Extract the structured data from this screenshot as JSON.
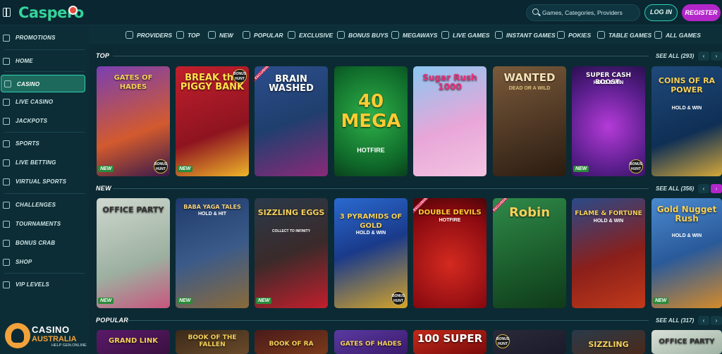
{
  "header": {
    "logo": "Caspero",
    "search_placeholder": "Games, Categories, Providers",
    "login_label": "LOG IN",
    "register_label": "REGISTER"
  },
  "sidebar": {
    "items": [
      {
        "label": "PROMOTIONS",
        "icon": "promotions-icon"
      },
      {
        "label": "HOME",
        "icon": "home-icon"
      },
      {
        "label": "CASINO",
        "icon": "casino-icon",
        "active": true
      },
      {
        "label": "LIVE CASINO",
        "icon": "live-casino-icon"
      },
      {
        "label": "JACKPOTS",
        "icon": "jackpots-icon"
      },
      {
        "label": "SPORTS",
        "icon": "sports-icon"
      },
      {
        "label": "LIVE BETTING",
        "icon": "live-betting-icon"
      },
      {
        "label": "VIRTUAL SPORTS",
        "icon": "virtual-sports-icon"
      },
      {
        "label": "CHALLENGES",
        "icon": "challenges-icon"
      },
      {
        "label": "TOURNAMENTS",
        "icon": "tournaments-icon"
      },
      {
        "label": "BONUS CRAB",
        "icon": "bonus-crab-icon"
      },
      {
        "label": "SHOP",
        "icon": "shop-icon"
      },
      {
        "label": "VIP LEVELS",
        "icon": "vip-levels-icon"
      }
    ]
  },
  "categories": [
    {
      "label": "PROVIDERS",
      "icon": "providers-icon"
    },
    {
      "label": "TOP",
      "icon": "top-icon"
    },
    {
      "label": "NEW",
      "icon": "new-icon"
    },
    {
      "label": "POPULAR",
      "icon": "popular-icon"
    },
    {
      "label": "EXCLUSIVE",
      "icon": "exclusive-icon"
    },
    {
      "label": "BONUS BUYS",
      "icon": "bonus-buys-icon"
    },
    {
      "label": "MEGAWAYS",
      "icon": "megaways-icon"
    },
    {
      "label": "LIVE GAMES",
      "icon": "live-games-icon"
    },
    {
      "label": "INSTANT GAMES",
      "icon": "instant-games-icon"
    },
    {
      "label": "POKIES",
      "icon": "pokies-icon"
    },
    {
      "label": "TABLE GAMES",
      "icon": "table-games-icon"
    },
    {
      "label": "ALL GAMES",
      "icon": "all-games-icon"
    }
  ],
  "sections": [
    {
      "title": "TOP",
      "see_all": "SEE ALL (293)",
      "games": [
        {
          "title": "GATES OF HADES",
          "sub": "",
          "new": "NEW",
          "hunt": true,
          "excl": false
        },
        {
          "title": "BREAK the PIGGY BANK",
          "sub": "",
          "new": "NEW",
          "hunt": true,
          "excl": false
        },
        {
          "title": "BRAIN WASHED",
          "sub": "",
          "new": "",
          "hunt": false,
          "excl": true
        },
        {
          "title": "40 MEGA",
          "sub": "HOTFIRE",
          "new": "",
          "hunt": false,
          "excl": false
        },
        {
          "title": "Sugar Rush 1000",
          "sub": "",
          "new": "",
          "hunt": false,
          "excl": false
        },
        {
          "title": "WANTED",
          "sub": "DEAD OR A WILD",
          "new": "",
          "hunt": false,
          "excl": false
        },
        {
          "title": "SUPER CASH BOOST:",
          "sub": "HOLD & WIN",
          "new": "NEW",
          "hunt": true,
          "excl": false
        },
        {
          "title": "COINS OF RA POWER",
          "sub": "HOLD & WIN",
          "new": "",
          "hunt": false,
          "excl": false
        }
      ]
    },
    {
      "title": "NEW",
      "see_all": "SEE ALL (356)",
      "games": [
        {
          "title": "OFFICE PARTY",
          "sub": "",
          "new": "NEW",
          "hunt": false,
          "excl": false
        },
        {
          "title": "BABA YAGA TALES",
          "sub": "HOLD & HIT",
          "new": "NEW",
          "hunt": false,
          "excl": false
        },
        {
          "title": "SIZZLING EGGS",
          "sub": "COLLECT TO INFINITY",
          "new": "NEW",
          "hunt": false,
          "excl": false
        },
        {
          "title": "3 PYRAMIDS OF GOLD",
          "sub": "HOLD & WIN",
          "new": "",
          "hunt": true,
          "excl": false
        },
        {
          "title": "DOUBLE DEVILS",
          "sub": "HOTFIRE",
          "new": "",
          "hunt": false,
          "excl": true
        },
        {
          "title": "Robin",
          "sub": "",
          "new": "",
          "hunt": false,
          "excl": true
        },
        {
          "title": "FLAME & FORTUNE",
          "sub": "HOLD & WIN",
          "new": "",
          "hunt": false,
          "excl": false
        },
        {
          "title": "Gold Nugget Rush",
          "sub": "HOLD & WIN",
          "new": "NEW",
          "hunt": false,
          "excl": false
        }
      ]
    },
    {
      "title": "POPULAR",
      "see_all": "SEE ALL (317)",
      "games": [
        {
          "title": "GRAND LINK",
          "sub": "",
          "new": "",
          "hunt": false,
          "excl": false
        },
        {
          "title": "BOOK OF THE FALLEN",
          "sub": "",
          "new": "",
          "hunt": false,
          "excl": false
        },
        {
          "title": "BOOK OF RA",
          "sub": "",
          "new": "",
          "hunt": false,
          "excl": false
        },
        {
          "title": "GATES OF HADES",
          "sub": "",
          "new": "",
          "hunt": false,
          "excl": false
        },
        {
          "title": "100 SUPER",
          "sub": "",
          "new": "",
          "hunt": false,
          "excl": false
        },
        {
          "title": "",
          "sub": "",
          "new": "",
          "hunt": true,
          "excl": false
        },
        {
          "title": "SIZZLING",
          "sub": "",
          "new": "",
          "hunt": false,
          "excl": false
        },
        {
          "title": "OFFICE PARTY",
          "sub": "",
          "new": "",
          "hunt": false,
          "excl": false
        }
      ]
    }
  ],
  "brand": {
    "line1": "CASINO",
    "line2": "AUSTRALIA",
    "line3": "HELP GEN.ONLINE"
  },
  "colors": {
    "background": "#0c2a33",
    "accent": "#2fd0b4",
    "register": "#b326c9"
  }
}
